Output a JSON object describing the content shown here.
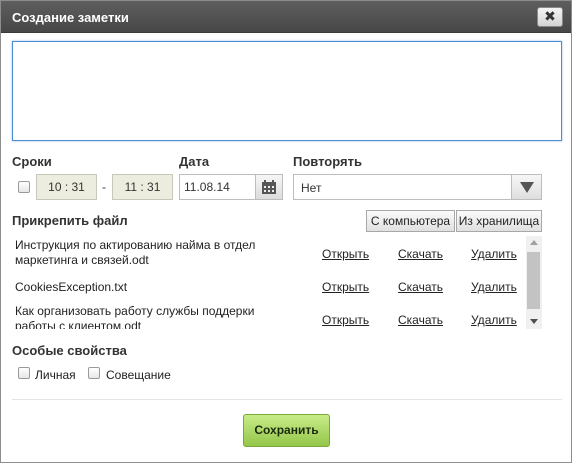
{
  "dialog": {
    "title": "Создание заметки",
    "close_label": "✖"
  },
  "note": {
    "value": ""
  },
  "timing": {
    "label": "Сроки",
    "enabled": false,
    "start": "10 : 31",
    "separator": "-",
    "end": "11 : 31"
  },
  "date": {
    "label": "Дата",
    "value": "11.08.14",
    "icon": "calendar-icon"
  },
  "repeat": {
    "label": "Повторять",
    "value": "Нет"
  },
  "attach": {
    "label": "Прикрепить файл",
    "from_computer": "С компьютера",
    "from_storage": "Из хранилища",
    "files": [
      {
        "name": "Инструкция по актированию найма в отдел маркетинга и связей.odt",
        "open": "Открыть",
        "download": "Скачать",
        "delete": "Удалить"
      },
      {
        "name": "CookiesException.txt",
        "open": "Открыть",
        "download": "Скачать",
        "delete": "Удалить"
      },
      {
        "name": "Как организовать работу службы поддерки работы с клиентом.odt",
        "open": "Открыть",
        "download": "Скачать",
        "delete": "Удалить"
      }
    ]
  },
  "properties": {
    "label": "Особые свойства",
    "personal": "Личная",
    "meeting": "Совещание"
  },
  "footer": {
    "save": "Сохранить"
  },
  "colors": {
    "accent": "#94c64a",
    "titlebar": "#4d4d4d",
    "focus": "#4a8fd3"
  }
}
